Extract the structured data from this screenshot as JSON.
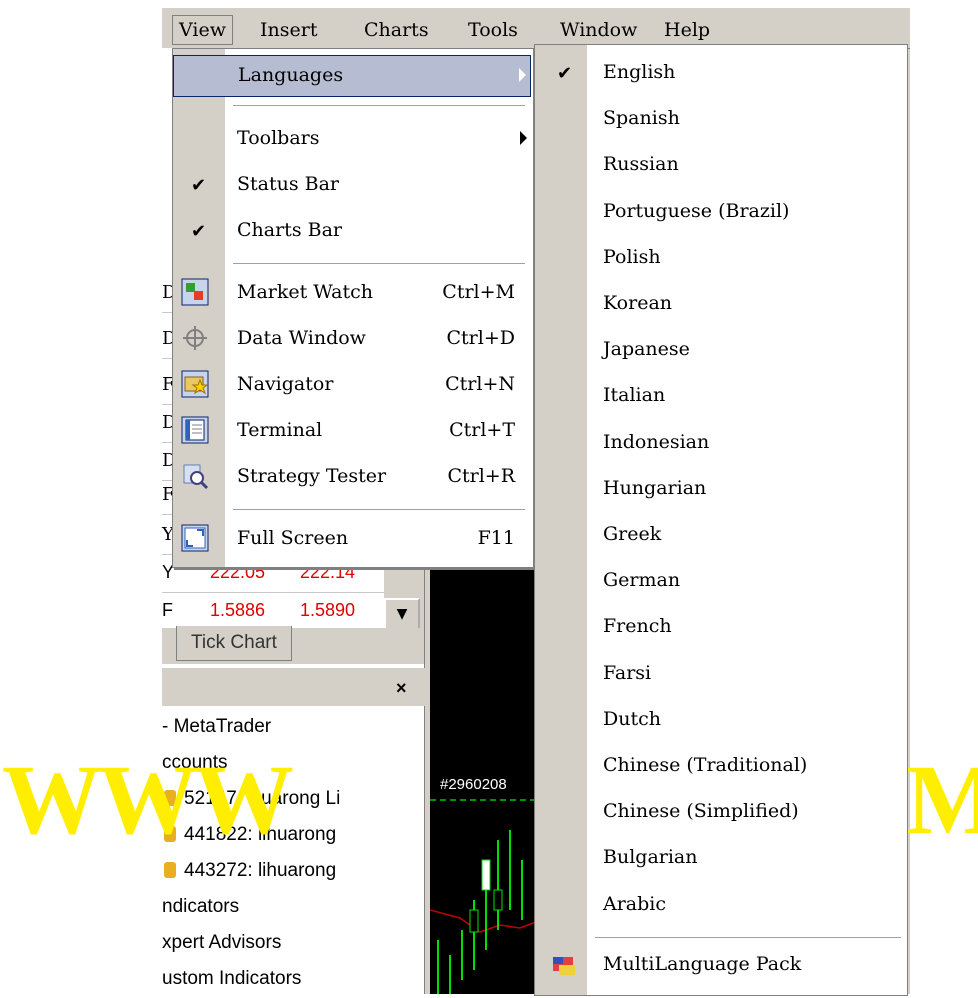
{
  "menubar": {
    "items": [
      {
        "label": "View",
        "active": true
      },
      {
        "label": "Insert"
      },
      {
        "label": "Charts"
      },
      {
        "label": "Tools"
      },
      {
        "label": "Window"
      },
      {
        "label": "Help"
      }
    ]
  },
  "view_menu": {
    "items": [
      {
        "label": "Languages",
        "submenu": true,
        "highlight": true
      },
      {
        "label": "Toolbars",
        "submenu": true
      },
      {
        "label": "Status Bar",
        "checked": true
      },
      {
        "label": "Charts Bar",
        "checked": true
      },
      {
        "label": "Market Watch",
        "shortcut": "Ctrl+M",
        "icon": "market-watch-icon"
      },
      {
        "label": "Data Window",
        "shortcut": "Ctrl+D",
        "icon": "crosshair-icon"
      },
      {
        "label": "Navigator",
        "shortcut": "Ctrl+N",
        "icon": "navigator-icon"
      },
      {
        "label": "Terminal",
        "shortcut": "Ctrl+T",
        "icon": "terminal-icon"
      },
      {
        "label": "Strategy Tester",
        "shortcut": "Ctrl+R",
        "icon": "tester-icon"
      },
      {
        "label": "Full Screen",
        "shortcut": "F11",
        "icon": "fullscreen-icon"
      }
    ]
  },
  "languages_menu": {
    "items": [
      {
        "label": "English",
        "checked": true
      },
      {
        "label": "Spanish"
      },
      {
        "label": "Russian"
      },
      {
        "label": "Portuguese (Brazil)"
      },
      {
        "label": "Polish"
      },
      {
        "label": "Korean"
      },
      {
        "label": "Japanese"
      },
      {
        "label": "Italian"
      },
      {
        "label": "Indonesian"
      },
      {
        "label": "Hungarian"
      },
      {
        "label": "Greek"
      },
      {
        "label": "German"
      },
      {
        "label": "French"
      },
      {
        "label": "Farsi"
      },
      {
        "label": "Dutch"
      },
      {
        "label": "Chinese (Traditional)"
      },
      {
        "label": "Chinese (Simplified)"
      },
      {
        "label": "Bulgarian"
      },
      {
        "label": "Arabic"
      }
    ],
    "extra": {
      "label": "MultiLanguage Pack",
      "icon": "multilanguage-pack-icon"
    }
  },
  "market_watch": {
    "rows": [
      {
        "symbol": "D"
      },
      {
        "symbol": "D"
      },
      {
        "symbol": "F"
      },
      {
        "symbol": "D"
      },
      {
        "symbol": "D"
      },
      {
        "symbol": "F"
      },
      {
        "symbol": "Y"
      },
      {
        "symbol": "Y",
        "bid": "222.05",
        "ask": "222.14"
      },
      {
        "symbol": "F",
        "bid": "1.5886",
        "ask": "1.5890"
      }
    ],
    "tab": "Tick Chart"
  },
  "navigator": {
    "items": [
      "- MetaTrader",
      "ccounts",
      "52147: Huarong Li",
      "441822: lihuarong",
      "443272: lihuarong",
      "ndicators",
      "xpert Advisors",
      "ustom Indicators"
    ]
  },
  "chart": {
    "label": "#2960208"
  },
  "watermark": {
    "left": "WWW",
    "right": "M"
  },
  "colors": {
    "menu_highlight": "#b6bdd2",
    "price_red": "#e00000",
    "watermark": "#ffee00"
  }
}
